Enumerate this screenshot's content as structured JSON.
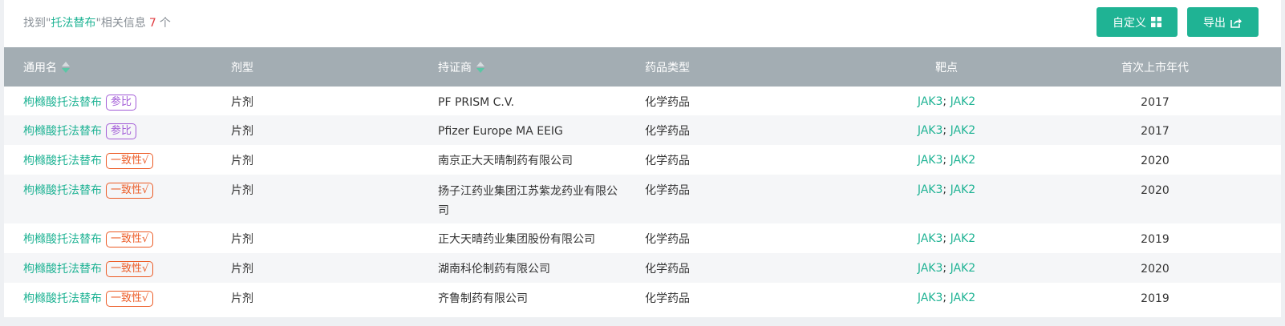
{
  "summary": {
    "prefix": "找到\"",
    "keyword": "托法替布",
    "suffix": "\"相关信息",
    "count": "7",
    "unit": "个"
  },
  "toolbar": {
    "custom_label": "自定义",
    "export_label": "导出"
  },
  "colors": {
    "accent": "#1fb394",
    "header_bg": "#a3adb3",
    "badge_ref": "#a25bd7",
    "badge_consistency": "#ec5a24",
    "count_red": "#e0393e"
  },
  "table": {
    "columns": {
      "name": "通用名",
      "form": "剂型",
      "holder": "持证商",
      "type": "药品类型",
      "target": "靶点",
      "year": "首次上市年代"
    },
    "rows": [
      {
        "name": "枸橼酸托法替布",
        "badge": "参比",
        "badge_kind": "ref",
        "form": "片剂",
        "holder": "PF PRISM C.V.",
        "type": "化学药品",
        "target1": "JAK3",
        "target2": "JAK2",
        "year": "2017"
      },
      {
        "name": "枸橼酸托法替布",
        "badge": "参比",
        "badge_kind": "ref",
        "form": "片剂",
        "holder": "Pfizer Europe MA EEIG",
        "type": "化学药品",
        "target1": "JAK3",
        "target2": "JAK2",
        "year": "2017"
      },
      {
        "name": "枸橼酸托法替布",
        "badge": "一致性√",
        "badge_kind": "cons",
        "form": "片剂",
        "holder": "南京正大天晴制药有限公司",
        "type": "化学药品",
        "target1": "JAK3",
        "target2": "JAK2",
        "year": "2020"
      },
      {
        "name": "枸橼酸托法替布",
        "badge": "一致性√",
        "badge_kind": "cons",
        "form": "片剂",
        "holder": "扬子江药业集团江苏紫龙药业有限公司",
        "type": "化学药品",
        "target1": "JAK3",
        "target2": "JAK2",
        "year": "2020"
      },
      {
        "name": "枸橼酸托法替布",
        "badge": "一致性√",
        "badge_kind": "cons",
        "form": "片剂",
        "holder": "正大天晴药业集团股份有限公司",
        "type": "化学药品",
        "target1": "JAK3",
        "target2": "JAK2",
        "year": "2019"
      },
      {
        "name": "枸橼酸托法替布",
        "badge": "一致性√",
        "badge_kind": "cons",
        "form": "片剂",
        "holder": "湖南科伦制药有限公司",
        "type": "化学药品",
        "target1": "JAK3",
        "target2": "JAK2",
        "year": "2020"
      },
      {
        "name": "枸橼酸托法替布",
        "badge": "一致性√",
        "badge_kind": "cons",
        "form": "片剂",
        "holder": "齐鲁制药有限公司",
        "type": "化学药品",
        "target1": "JAK3",
        "target2": "JAK2",
        "year": "2019"
      }
    ]
  }
}
